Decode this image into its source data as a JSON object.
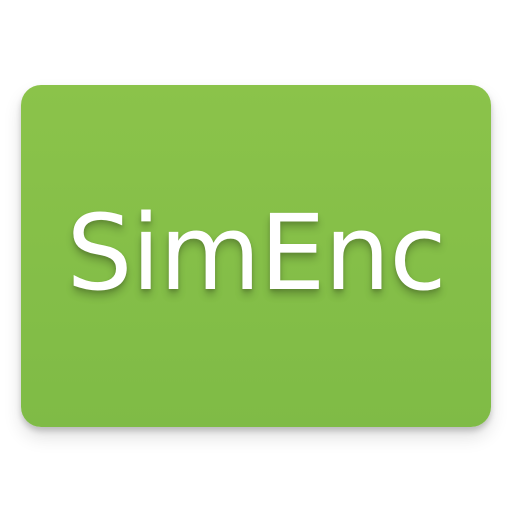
{
  "icon": {
    "title": "SimEnc",
    "background_color": "#8bc34a",
    "text_color": "#ffffff"
  }
}
